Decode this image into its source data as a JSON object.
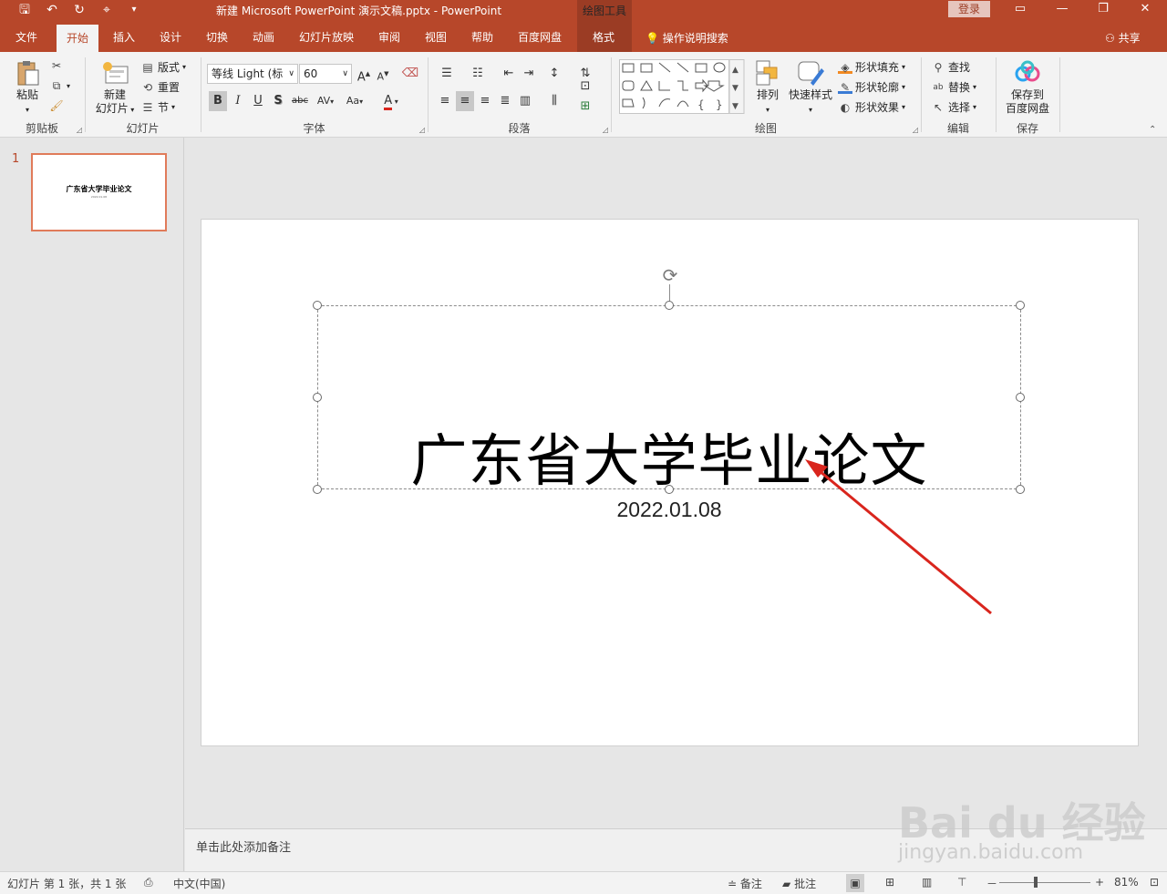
{
  "window": {
    "title": "新建 Microsoft PowerPoint 演示文稿.pptx  -  PowerPoint",
    "context_tools": "绘图工具",
    "login": "登录"
  },
  "tabs": [
    "文件",
    "开始",
    "插入",
    "设计",
    "切换",
    "动画",
    "幻灯片放映",
    "审阅",
    "视图",
    "帮助",
    "百度网盘",
    "格式"
  ],
  "active_tab": "开始",
  "tell_me": "操作说明搜索",
  "share": "共享",
  "ribbon": {
    "clipboard": {
      "paste": "粘贴",
      "label": "剪贴板"
    },
    "slides": {
      "new_slide_1": "新建",
      "new_slide_2": "幻灯片",
      "layout": "版式",
      "reset": "重置",
      "section": "节",
      "label": "幻灯片"
    },
    "font": {
      "family": "等线 Light (标",
      "size": "60",
      "bold": "B",
      "italic": "I",
      "underline": "U",
      "shadow": "S",
      "strike": "abc",
      "spacing": "AV",
      "case": "Aa",
      "color": "A",
      "grow": "A",
      "shrink": "A",
      "label": "字体"
    },
    "paragraph": {
      "label": "段落"
    },
    "drawing": {
      "arrange": "排列",
      "quick_styles": "快速样式",
      "fill": "形状填充",
      "outline": "形状轮廓",
      "effects": "形状效果",
      "label": "绘图"
    },
    "editing": {
      "find": "查找",
      "replace": "替换",
      "select": "选择",
      "label": "编辑"
    },
    "save": {
      "line1": "保存到",
      "line2": "百度网盘",
      "label": "保存"
    }
  },
  "thumbnail": {
    "number": "1",
    "title": "广东省大学毕业论文",
    "subtitle": "2022.01.08"
  },
  "slide": {
    "title": "广东省大学毕业论文",
    "subtitle": "2022.01.08"
  },
  "notes_placeholder": "单击此处添加备注",
  "status": {
    "slide_info": "幻灯片 第 1 张，共 1 张",
    "language": "中文(中国)",
    "notes": "备注",
    "comments": "批注",
    "zoom_minus": "－",
    "zoom_plus": "+",
    "zoom": "81%"
  },
  "watermark": {
    "main": "Bai du 经验",
    "sub": "jingyan.baidu.com"
  },
  "colors": {
    "accent": "#b7472a",
    "annotation_arrow": "#d9251d"
  }
}
